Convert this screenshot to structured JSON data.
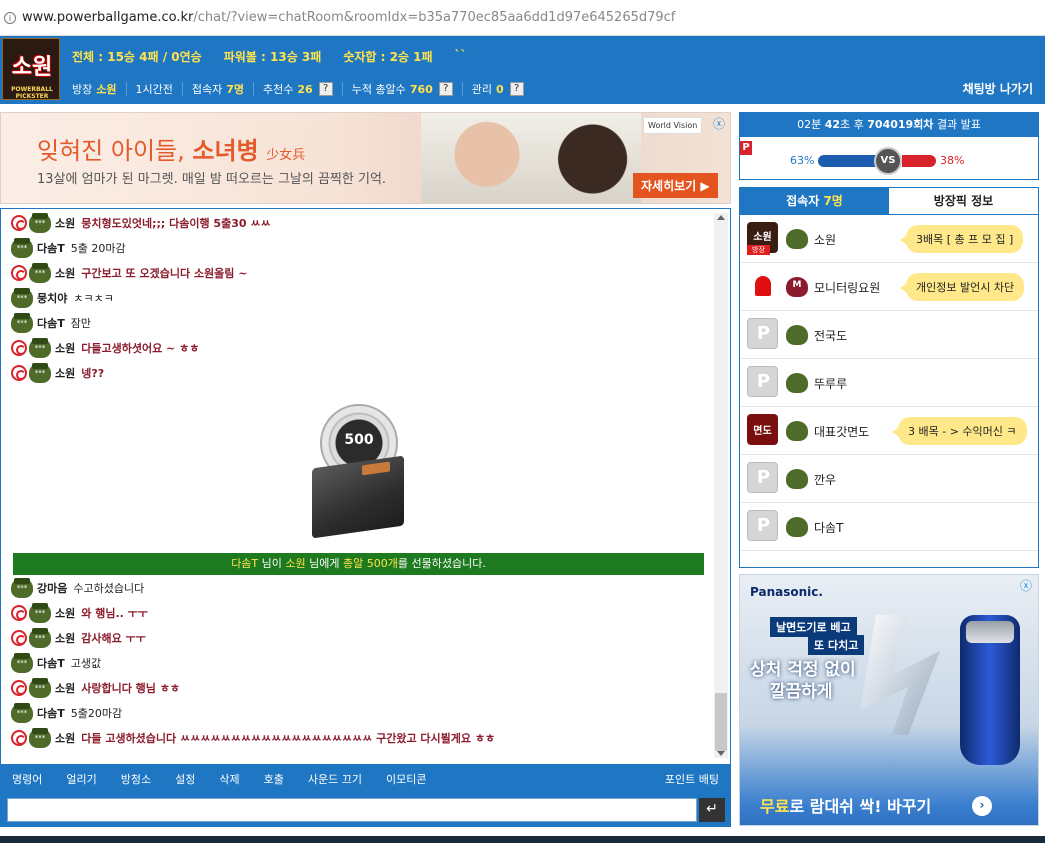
{
  "browser": {
    "host": "www.powerballgame.co.kr",
    "path": "/chat/?view=chatRoom&roomIdx=b35a770ec85aa6dd1d97e645265d79cf"
  },
  "header": {
    "logo_text": "소원",
    "logo_sub": "POWERBALL PICKSTER",
    "stats": [
      "전체 : 15승 4패 / 0연승",
      "파워볼 : 13승 3패",
      "숫자합 : 2승 1패",
      "``"
    ],
    "info": {
      "owner_label": "방장",
      "owner": "소원",
      "time": "1시간전",
      "users_label": "접속자",
      "users": "7명",
      "recommend_label": "추천수",
      "recommend": "26",
      "gifts_label": "누적 총알수",
      "gifts": "760",
      "manage_label": "관리",
      "manage": "0",
      "q": "?"
    },
    "leave": "채팅방 나가기"
  },
  "ad_top": {
    "headline": "잊혀진 아이들,",
    "headline_bold": "소녀병",
    "headline_han": "少女兵",
    "sub": "13살에 엄마가 된 마그렛. 매일 밤 떠오르는 그날의 끔찍한 기억.",
    "brand": "World Vision",
    "cta": "자세히보기 ▶",
    "close": "ⓧ"
  },
  "messages": [
    {
      "name": "소원",
      "text": "뭉치형도있엇네;;; 다솜이행 5출30 ㅆㅆ",
      "style": "red"
    },
    {
      "name": "다솜T",
      "text": "5출 20마감",
      "style": "plain"
    },
    {
      "name": "소원",
      "text": "구간보고 또 오겠습니다 소원올림 ~",
      "style": "red"
    },
    {
      "name": "뭉치야",
      "text": "ㅊㅋㅊㅋ",
      "style": "plain"
    },
    {
      "name": "다솜T",
      "text": "잠만",
      "style": "plain"
    },
    {
      "name": "소원",
      "text": "다들고생하셧어요 ~ ㅎㅎ",
      "style": "red"
    },
    {
      "name": "소원",
      "text": "넹??",
      "style": "red"
    }
  ],
  "gift": {
    "count": "500"
  },
  "notice": {
    "from": "다솜T",
    "mid1": " 님이 ",
    "to": "소원",
    "mid2": " 님에게 ",
    "amount": "총알 500개",
    "end": "를 선물하셨습니다."
  },
  "messages2": [
    {
      "name": "강마음",
      "text": "수고하셨습니다",
      "style": "plain"
    },
    {
      "name": "소원",
      "text": "와 행님.. ㅜㅜ",
      "style": "red"
    },
    {
      "name": "소원",
      "text": "감사해요 ㅜㅜ",
      "style": "red"
    },
    {
      "name": "다솜T",
      "text": "고생값",
      "style": "plain"
    },
    {
      "name": "소원",
      "text": "사랑합니다 행님 ㅎㅎ",
      "style": "red"
    },
    {
      "name": "다솜T",
      "text": "5출20마감",
      "style": "plain"
    },
    {
      "name": "소원",
      "text": "다들 고생하셨습니다 ㅆㅆㅆㅆㅆㅆㅆㅆㅆㅆㅆㅆㅆㅆㅆㅆㅆㅆㅆ 구간왔고 다시뵐게요 ㅎㅎ",
      "style": "red"
    }
  ],
  "menu": [
    "명령어",
    "얼리기",
    "방청소",
    "설정",
    "삭제",
    "호출",
    "사운드 끄기",
    "이모티콘"
  ],
  "menu_right": "포인트 배팅",
  "input": {
    "placeholder": "",
    "send": "↵"
  },
  "result": {
    "pre": "02분",
    "sec": "42",
    "mid": "초 후",
    "round": "704019회차",
    "post": "결과 발표",
    "p": "P",
    "pct_blue": "63%",
    "pct_red": "38%",
    "vs": "VS",
    "share_blue": 0.63,
    "share_red": 0.38
  },
  "users_panel": {
    "tab_users_label": "접속자",
    "tab_users_count": "7명",
    "tab_pick": "방장픽 정보",
    "rows": [
      {
        "name": "소원",
        "bubble": "3배목 [ 총 프 모 집 ]",
        "av": "logo2",
        "tag": "방장",
        "rank": "normal"
      },
      {
        "name": "모니터링요원",
        "bubble": "개인정보 발언시 차단",
        "av": "siren",
        "tag": "",
        "rank": "m"
      },
      {
        "name": "전국도",
        "bubble": "",
        "av": "p",
        "tag": "",
        "rank": "normal"
      },
      {
        "name": "뚜루루",
        "bubble": "",
        "av": "p",
        "tag": "",
        "rank": "normal"
      },
      {
        "name": "대표갓면도",
        "bubble": "3 배목 - > 수익머신 ㅋ",
        "av": "red",
        "tag": "",
        "rank": "normal"
      },
      {
        "name": "깐우",
        "bubble": "",
        "av": "p",
        "tag": "",
        "rank": "normal"
      },
      {
        "name": "다솜T",
        "bubble": "",
        "av": "p",
        "tag": "",
        "rank": "normal"
      }
    ]
  },
  "ad_side": {
    "brand": "Panasonic.",
    "l1": "날면도기로 베고",
    "l2": "또 다치고",
    "l3": "상처 걱정 없이",
    "l4": "깔끔하게",
    "bottom_y": "무료",
    "bottom_rest": "로 람대쉬 싹! 바꾸기",
    "arrow": "›",
    "close": "ⓧ"
  },
  "colors": {
    "primary": "#1f77c3",
    "accent": "#ffe34d",
    "red": "#d9232a",
    "notice_green": "#1e7a1e"
  }
}
